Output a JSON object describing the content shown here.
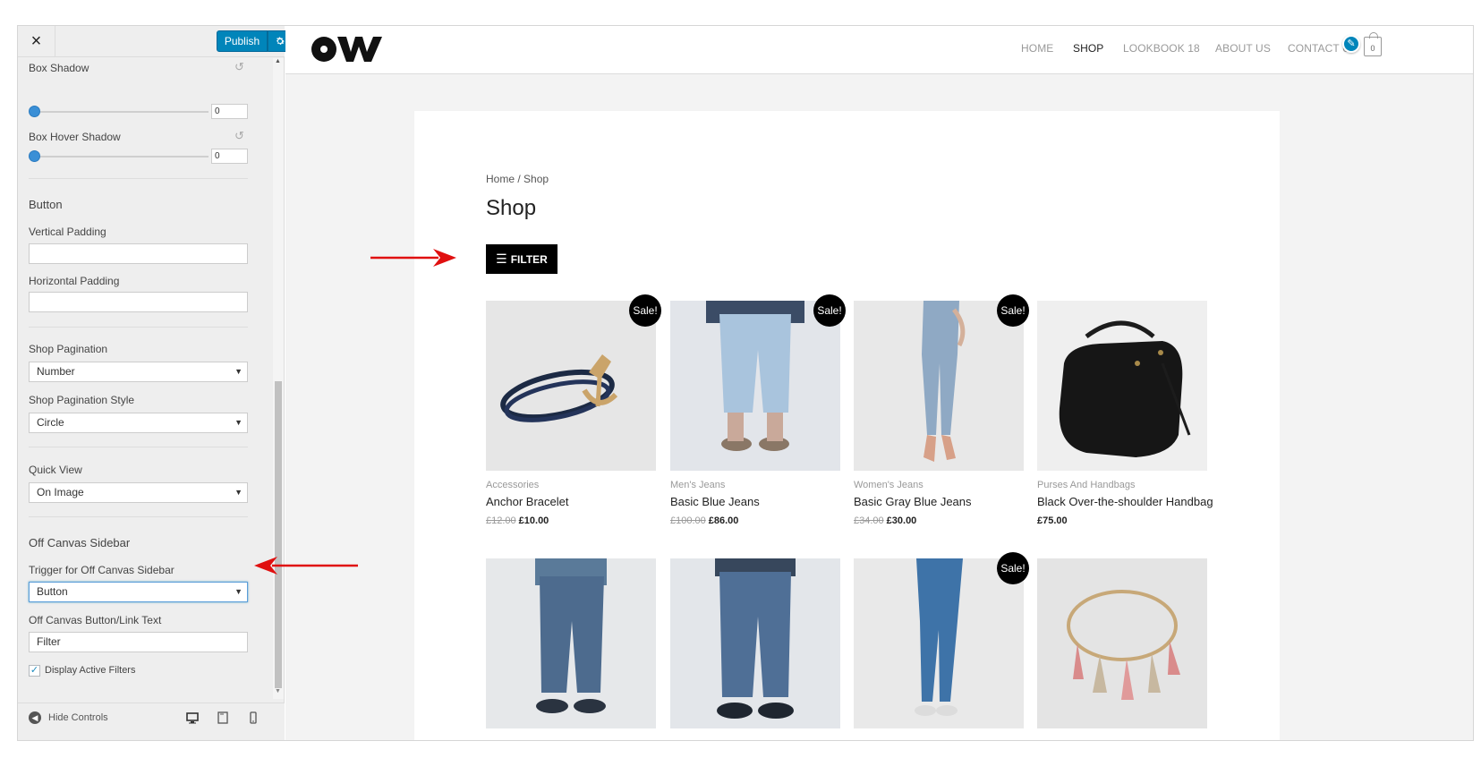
{
  "customizer": {
    "close_icon": "×",
    "publish_label": "Publish",
    "publish_settings_icon": "gear-icon",
    "box_shadow": {
      "label": "Box Shadow",
      "value": "0"
    },
    "box_hover_shadow": {
      "label": "Box Hover Shadow",
      "value": "0"
    },
    "button_section": "Button",
    "vertical_padding": {
      "label": "Vertical Padding",
      "value": ""
    },
    "horizontal_padding": {
      "label": "Horizontal Padding",
      "value": ""
    },
    "shop_pagination": {
      "label": "Shop Pagination",
      "value": "Number"
    },
    "shop_pagination_style": {
      "label": "Shop Pagination Style",
      "value": "Circle"
    },
    "quick_view": {
      "label": "Quick View",
      "value": "On Image"
    },
    "off_canvas_section": "Off Canvas Sidebar",
    "off_canvas_trigger": {
      "label": "Trigger for Off Canvas Sidebar",
      "value": "Button"
    },
    "off_canvas_text": {
      "label": "Off Canvas Button/Link Text",
      "value": "Filter"
    },
    "display_active_filters": {
      "label": "Display Active Filters",
      "checked": true
    },
    "footer": {
      "hide_controls": "Hide Controls"
    },
    "accent_color": "#0085ba"
  },
  "site": {
    "logo_icon": "ow-logo",
    "nav": [
      "HOME",
      "SHOP",
      "LOOKBOOK 18",
      "ABOUT US",
      "CONTACT US"
    ],
    "active_nav": "SHOP",
    "cart_count": "0",
    "breadcrumb": "Home / Shop",
    "page_title": "Shop",
    "filter_button": "FILTER",
    "sale_badge": "Sale!",
    "products": [
      {
        "category": "Accessories",
        "name": "Anchor Bracelet",
        "old_price": "£12.00",
        "price": "£10.00",
        "sale": true
      },
      {
        "category": "Men's Jeans",
        "name": "Basic Blue Jeans",
        "old_price": "£100.00",
        "price": "£86.00",
        "sale": true
      },
      {
        "category": "Women's Jeans",
        "name": "Basic Gray Blue Jeans",
        "old_price": "£34.00",
        "price": "£30.00",
        "sale": true
      },
      {
        "category": "Purses And Handbags",
        "name": "Black Over-the-shoulder Handbag",
        "old_price": "",
        "price": "£75.00",
        "sale": false
      }
    ],
    "row2_sale": [
      false,
      false,
      true,
      false
    ]
  }
}
